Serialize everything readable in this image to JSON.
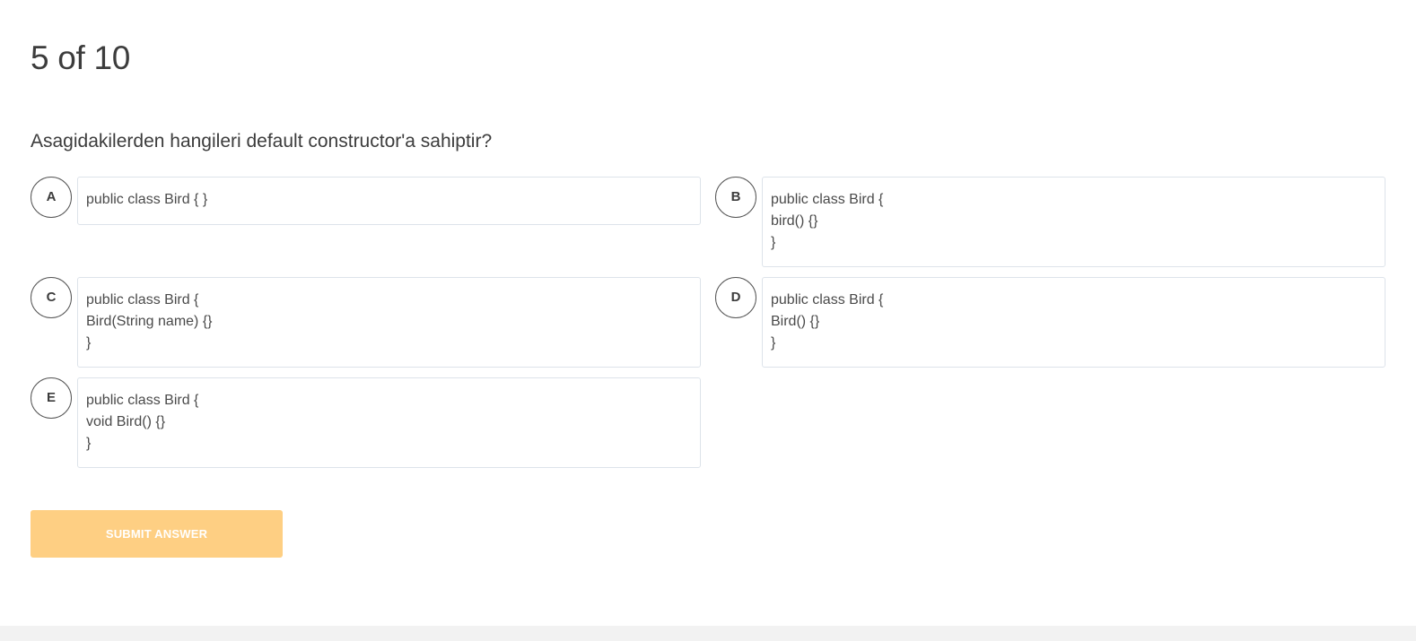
{
  "quiz": {
    "progress": "5 of 10",
    "question": "Asagidakilerden hangileri default constructor'a sahiptir?",
    "submit_label": "SUBMIT ANSWER",
    "submit_color": "#fecf83",
    "options": [
      {
        "letter": "A",
        "lines": [
          "public class Bird { }"
        ]
      },
      {
        "letter": "B",
        "lines": [
          "public class Bird {",
          "bird() {}",
          "}"
        ]
      },
      {
        "letter": "C",
        "lines": [
          "public class Bird {",
          "Bird(String name) {}",
          "}"
        ]
      },
      {
        "letter": "D",
        "lines": [
          "public class Bird {",
          "Bird() {}",
          "}"
        ]
      },
      {
        "letter": "E",
        "lines": [
          "public class Bird {",
          "void Bird() {}",
          "}"
        ]
      }
    ]
  }
}
